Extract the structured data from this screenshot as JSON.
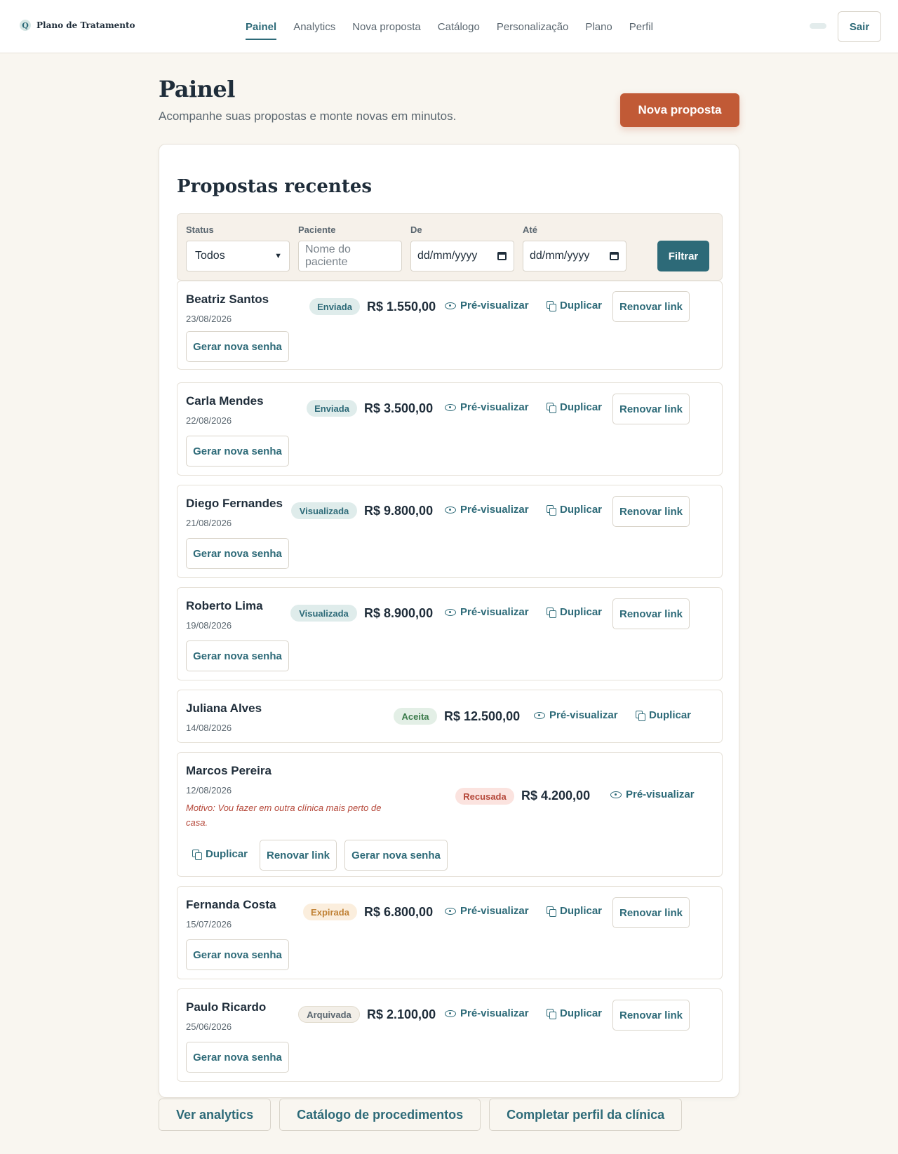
{
  "app": {
    "brand": "Plano de Tratamento",
    "brand_logo": "Q",
    "nav": [
      "Painel",
      "Analytics",
      "Nova proposta",
      "Catálogo",
      "Personalização",
      "Plano",
      "Perfil"
    ],
    "active_nav": "Painel",
    "logout": "Sair"
  },
  "header": {
    "title": "Painel",
    "subtitle": "Acompanhe suas propostas e monte novas em minutos.",
    "new_proposal": "Nova proposta"
  },
  "card": {
    "title": "Propostas recentes"
  },
  "filters": {
    "status_label": "Status",
    "status_value": "Todos",
    "patient_label": "Paciente",
    "patient_placeholder": "Nome do paciente",
    "from_label": "De",
    "from_placeholder": "dd/mm/yyyy",
    "to_label": "Até",
    "to_placeholder": "dd/mm/yyyy",
    "submit": "Filtrar"
  },
  "actions": {
    "preview": "Pré-visualizar",
    "duplicate": "Duplicar",
    "renew": "Renovar link",
    "new_password": "Gerar nova senha"
  },
  "proposals": [
    {
      "name": "Beatriz Santos",
      "date": "23/08/2026",
      "status": "Enviada",
      "value": "R$ 1.550,00"
    },
    {
      "name": "Carla Mendes",
      "date": "22/08/2026",
      "status": "Enviada",
      "value": "R$ 3.500,00"
    },
    {
      "name": "Diego Fernandes",
      "date": "21/08/2026",
      "status": "Visualizada",
      "value": "R$ 9.800,00"
    },
    {
      "name": "Roberto Lima",
      "date": "19/08/2026",
      "status": "Visualizada",
      "value": "R$ 8.900,00"
    },
    {
      "name": "Juliana Alves",
      "date": "14/08/2026",
      "status": "Aceita",
      "value": "R$ 12.500,00"
    },
    {
      "name": "Marcos Pereira",
      "date": "12/08/2026",
      "status": "Recusada",
      "value": "R$ 4.200,00",
      "reason": "Motivo: Vou fazer em outra clínica mais perto de casa."
    },
    {
      "name": "Fernanda Costa",
      "date": "15/07/2026",
      "status": "Expirada",
      "value": "R$ 6.800,00"
    },
    {
      "name": "Paulo Ricardo",
      "date": "25/06/2026",
      "status": "Arquivada",
      "value": "R$ 2.100,00"
    }
  ],
  "footer": {
    "analytics": "Ver analytics",
    "catalog": "Catálogo de procedimentos",
    "profile": "Completar perfil da clínica"
  },
  "colors": {
    "accent": "#2d6a78",
    "primary": "#c15a36",
    "background": "#f9f6f0"
  },
  "icons": {
    "preview": "eye-icon",
    "duplicate": "copy-icon",
    "select": "chevron-down-icon",
    "date": "calendar-icon",
    "brand": "logo-icon"
  }
}
